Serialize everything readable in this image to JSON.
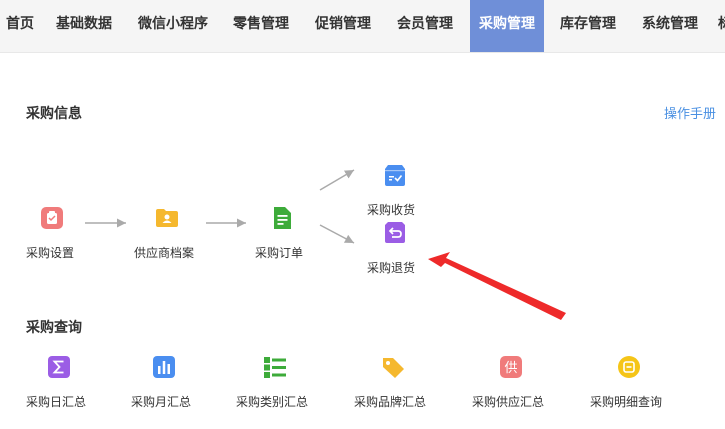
{
  "nav": {
    "items": [
      "首页",
      "基础数据",
      "微信小程序",
      "零售管理",
      "促销管理",
      "会员管理",
      "采购管理",
      "库存管理",
      "系统管理",
      "标"
    ],
    "active_index": 6,
    "active_color": "#6f8fd8"
  },
  "purchase_info": {
    "title": "采购信息",
    "manual_label": "操作手册",
    "flow": [
      {
        "label": "采购设置",
        "icon": "clipboard-icon",
        "color": "#f07b7b"
      },
      {
        "label": "供应商档案",
        "icon": "folder-user-icon",
        "color": "#f5b82e"
      },
      {
        "label": "采购订单",
        "icon": "document-icon",
        "color": "#3dab3a"
      },
      {
        "label": "采购收货",
        "icon": "inbox-check-icon",
        "color": "#4a8ef0"
      },
      {
        "label": "采购退货",
        "icon": "return-box-icon",
        "color": "#9b5de5"
      }
    ]
  },
  "purchase_query": {
    "title": "采购查询",
    "items": [
      {
        "label": "采购日汇总",
        "icon": "sigma-icon",
        "color": "#9b5de5"
      },
      {
        "label": "采购月汇总",
        "icon": "bar-chart-icon",
        "color": "#4a8ef0"
      },
      {
        "label": "采购类别汇总",
        "icon": "list-icon",
        "color": "#3dab3a"
      },
      {
        "label": "采购品牌汇总",
        "icon": "tag-icon",
        "color": "#f5b82e"
      },
      {
        "label": "采购供应汇总",
        "icon": "supply-badge-icon",
        "color": "#f07b7b",
        "badge_text": "供"
      },
      {
        "label": "采购明细查询",
        "icon": "detail-circle-icon",
        "color": "#f5c518"
      }
    ]
  },
  "annotation": {
    "color": "#ee2a2a"
  }
}
